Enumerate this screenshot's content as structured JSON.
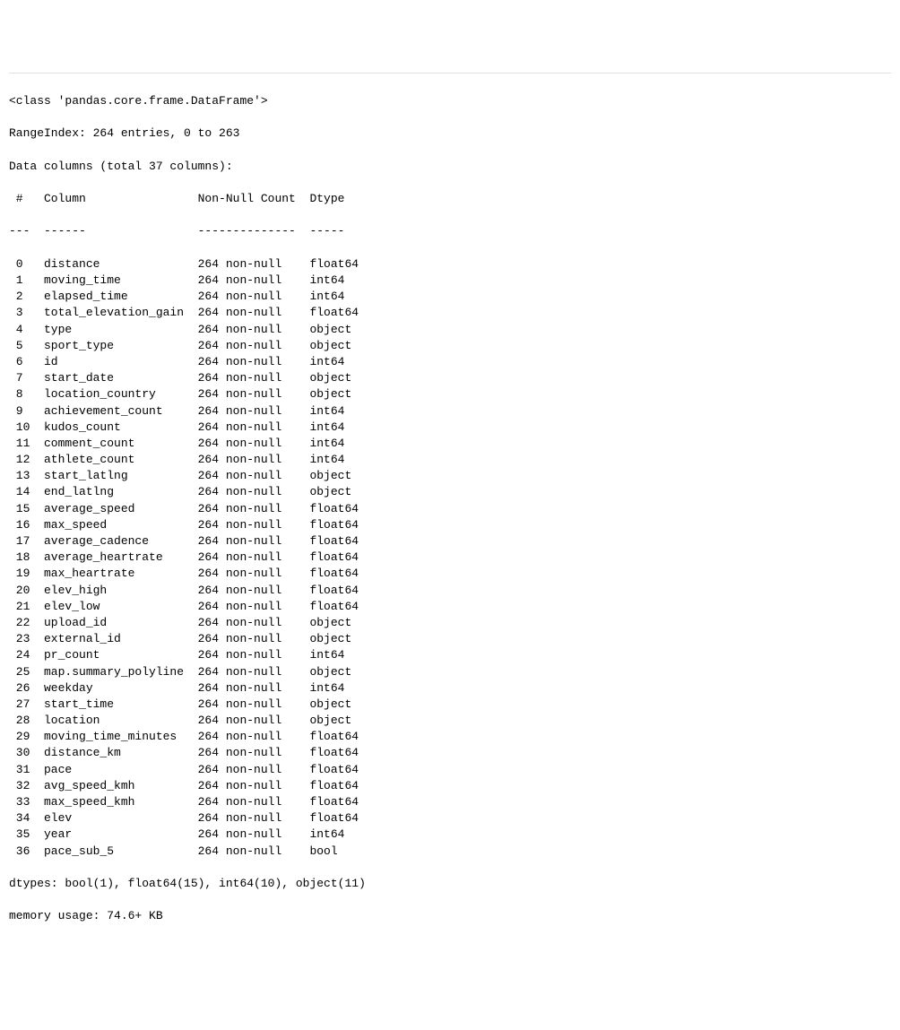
{
  "header": {
    "class_line": "<class 'pandas.core.frame.DataFrame'>",
    "range_index": "RangeIndex: 264 entries, 0 to 263",
    "data_columns": "Data columns (total 37 columns):"
  },
  "column_header": {
    "hash": " #",
    "column": "Column",
    "nonnull": "Non-Null Count",
    "dtype": "Dtype"
  },
  "divider": {
    "hash": "---",
    "column": "------",
    "nonnull": "--------------",
    "dtype": "-----"
  },
  "columns": [
    {
      "idx": " 0",
      "name": "distance",
      "nonnull": "264 non-null",
      "dtype": "float64"
    },
    {
      "idx": " 1",
      "name": "moving_time",
      "nonnull": "264 non-null",
      "dtype": "int64  "
    },
    {
      "idx": " 2",
      "name": "elapsed_time",
      "nonnull": "264 non-null",
      "dtype": "int64  "
    },
    {
      "idx": " 3",
      "name": "total_elevation_gain",
      "nonnull": "264 non-null",
      "dtype": "float64"
    },
    {
      "idx": " 4",
      "name": "type",
      "nonnull": "264 non-null",
      "dtype": "object "
    },
    {
      "idx": " 5",
      "name": "sport_type",
      "nonnull": "264 non-null",
      "dtype": "object "
    },
    {
      "idx": " 6",
      "name": "id",
      "nonnull": "264 non-null",
      "dtype": "int64  "
    },
    {
      "idx": " 7",
      "name": "start_date",
      "nonnull": "264 non-null",
      "dtype": "object "
    },
    {
      "idx": " 8",
      "name": "location_country",
      "nonnull": "264 non-null",
      "dtype": "object "
    },
    {
      "idx": " 9",
      "name": "achievement_count",
      "nonnull": "264 non-null",
      "dtype": "int64  "
    },
    {
      "idx": " 10",
      "name": "kudos_count",
      "nonnull": "264 non-null",
      "dtype": "int64  "
    },
    {
      "idx": " 11",
      "name": "comment_count",
      "nonnull": "264 non-null",
      "dtype": "int64  "
    },
    {
      "idx": " 12",
      "name": "athlete_count",
      "nonnull": "264 non-null",
      "dtype": "int64  "
    },
    {
      "idx": " 13",
      "name": "start_latlng",
      "nonnull": "264 non-null",
      "dtype": "object "
    },
    {
      "idx": " 14",
      "name": "end_latlng",
      "nonnull": "264 non-null",
      "dtype": "object "
    },
    {
      "idx": " 15",
      "name": "average_speed",
      "nonnull": "264 non-null",
      "dtype": "float64"
    },
    {
      "idx": " 16",
      "name": "max_speed",
      "nonnull": "264 non-null",
      "dtype": "float64"
    },
    {
      "idx": " 17",
      "name": "average_cadence",
      "nonnull": "264 non-null",
      "dtype": "float64"
    },
    {
      "idx": " 18",
      "name": "average_heartrate",
      "nonnull": "264 non-null",
      "dtype": "float64"
    },
    {
      "idx": " 19",
      "name": "max_heartrate",
      "nonnull": "264 non-null",
      "dtype": "float64"
    },
    {
      "idx": " 20",
      "name": "elev_high",
      "nonnull": "264 non-null",
      "dtype": "float64"
    },
    {
      "idx": " 21",
      "name": "elev_low",
      "nonnull": "264 non-null",
      "dtype": "float64"
    },
    {
      "idx": " 22",
      "name": "upload_id",
      "nonnull": "264 non-null",
      "dtype": "object "
    },
    {
      "idx": " 23",
      "name": "external_id",
      "nonnull": "264 non-null",
      "dtype": "object "
    },
    {
      "idx": " 24",
      "name": "pr_count",
      "nonnull": "264 non-null",
      "dtype": "int64  "
    },
    {
      "idx": " 25",
      "name": "map.summary_polyline",
      "nonnull": "264 non-null",
      "dtype": "object "
    },
    {
      "idx": " 26",
      "name": "weekday",
      "nonnull": "264 non-null",
      "dtype": "int64  "
    },
    {
      "idx": " 27",
      "name": "start_time",
      "nonnull": "264 non-null",
      "dtype": "object "
    },
    {
      "idx": " 28",
      "name": "location",
      "nonnull": "264 non-null",
      "dtype": "object "
    },
    {
      "idx": " 29",
      "name": "moving_time_minutes",
      "nonnull": "264 non-null",
      "dtype": "float64"
    },
    {
      "idx": " 30",
      "name": "distance_km",
      "nonnull": "264 non-null",
      "dtype": "float64"
    },
    {
      "idx": " 31",
      "name": "pace",
      "nonnull": "264 non-null",
      "dtype": "float64"
    },
    {
      "idx": " 32",
      "name": "avg_speed_kmh",
      "nonnull": "264 non-null",
      "dtype": "float64"
    },
    {
      "idx": " 33",
      "name": "max_speed_kmh",
      "nonnull": "264 non-null",
      "dtype": "float64"
    },
    {
      "idx": " 34",
      "name": "elev",
      "nonnull": "264 non-null",
      "dtype": "float64"
    },
    {
      "idx": " 35",
      "name": "year",
      "nonnull": "264 non-null",
      "dtype": "int64  "
    },
    {
      "idx": " 36",
      "name": "pace_sub_5",
      "nonnull": "264 non-null",
      "dtype": "bool   "
    }
  ],
  "footer": {
    "dtypes": "dtypes: bool(1), float64(15), int64(10), object(11)",
    "memory": "memory usage: 74.6+ KB"
  },
  "widths": {
    "idx": 3,
    "name": 22,
    "nonnull": 16,
    "dtype": 7
  }
}
